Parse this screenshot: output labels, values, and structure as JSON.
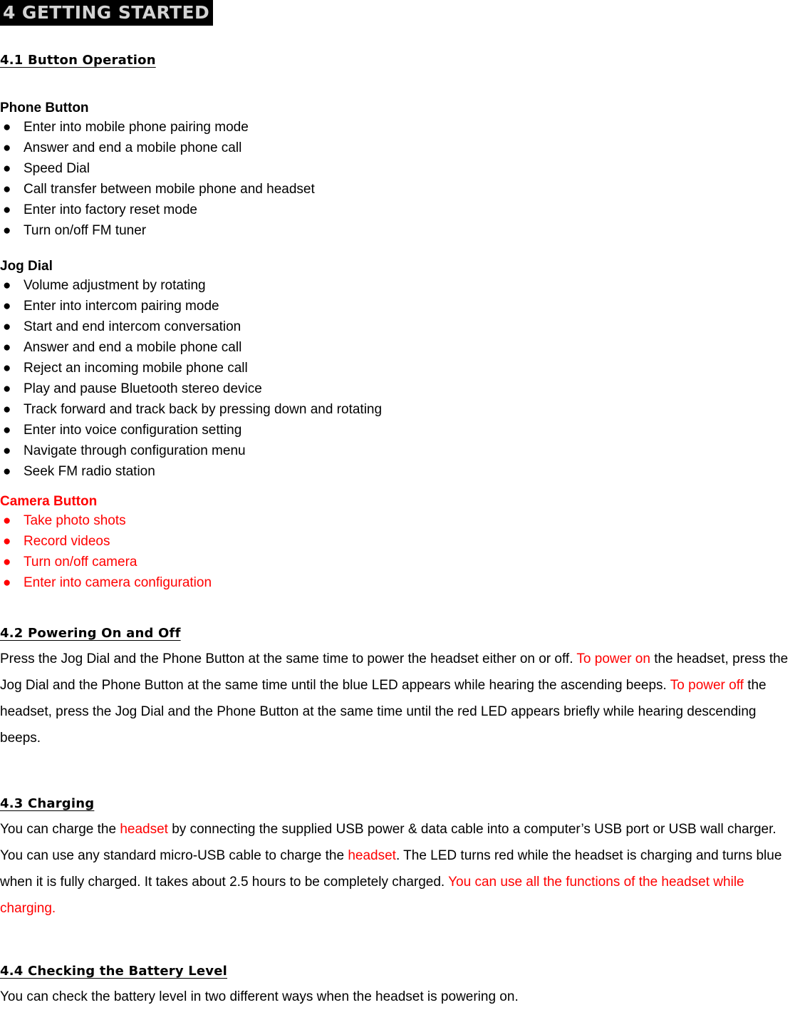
{
  "document": {
    "chapter_title": "4 GETTING STARTED",
    "colors": {
      "title_bar_background": "#000000",
      "title_bar_text": "#d4d4d4",
      "accent_red": "#ff0000",
      "body_text": "#000000",
      "page_background": "#ffffff"
    }
  },
  "sections": {
    "button_operation": {
      "heading": "4.1 Button Operation",
      "groups": [
        {
          "label": "Phone Button",
          "color": "black",
          "bullet_glyph": "●",
          "items": [
            "Enter into mobile phone pairing mode",
            "Answer and end a mobile phone call",
            "Speed Dial",
            "Call transfer between mobile phone and headset",
            "Enter into factory reset mode",
            "Turn on/off FM tuner"
          ]
        },
        {
          "label": "Jog Dial",
          "color": "black",
          "bullet_glyph": "●",
          "items": [
            "Volume adjustment by rotating",
            "Enter into intercom pairing mode",
            "Start and end intercom conversation",
            "Answer and end a mobile phone call",
            "Reject an incoming mobile phone call",
            "Play and pause Bluetooth stereo device",
            "Track forward and track back by pressing down and rotating",
            "Enter into voice configuration setting",
            "Navigate through configuration menu",
            "Seek FM radio station"
          ]
        },
        {
          "label": "Camera Button",
          "color": "red",
          "bullet_glyph": "●",
          "items": [
            "Take photo shots",
            "Record videos",
            "Turn on/off camera",
            "Enter into camera configuration"
          ]
        }
      ]
    },
    "powering_on_and_off": {
      "heading": "4.2 Powering On and Off",
      "paragraph": [
        {
          "text": "Press the Jog Dial and the Phone Button at the same time to power the headset either on or off. ",
          "color": "black"
        },
        {
          "text": "To power on",
          "color": "red"
        },
        {
          "text": " the headset, press the Jog Dial and the Phone Button at the same time until the blue LED appears while hearing the ascending beeps. ",
          "color": "black"
        },
        {
          "text": "To power off",
          "color": "red"
        },
        {
          "text": " the headset, press the Jog Dial and the Phone Button at the same time until the red LED appears briefly while hearing descending beeps.",
          "color": "black"
        }
      ]
    },
    "charging": {
      "heading": "4.3 Charging",
      "paragraph": [
        {
          "text": "You can charge the ",
          "color": "black"
        },
        {
          "text": "headset",
          "color": "red"
        },
        {
          "text": " by connecting the supplied USB power & data cable into a computer’s USB port or USB wall charger. You can use any standard micro-USB cable to charge the ",
          "color": "black"
        },
        {
          "text": "headset",
          "color": "red"
        },
        {
          "text": ". The LED turns red while the headset is charging and turns blue when it is fully charged. It takes about 2.5 hours to be completely charged. ",
          "color": "black"
        },
        {
          "text": "You can use all the functions of the headset while charging.",
          "color": "red"
        }
      ]
    },
    "checking_battery_level": {
      "heading": "4.4 Checking the Battery Level",
      "paragraph": [
        {
          "text": "You can check the battery level in two different ways when the headset is powering on.",
          "color": "black"
        }
      ]
    }
  }
}
